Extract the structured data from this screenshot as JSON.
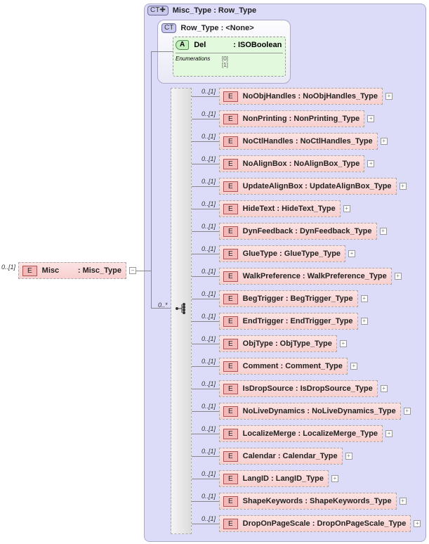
{
  "root": {
    "cardinality": "0..[1]",
    "badge": "E",
    "name": "Misc",
    "type": ": Misc_Type",
    "toggle": "−"
  },
  "complex_type": {
    "badge": "CT✚",
    "title": "Misc_Type : Row_Type"
  },
  "base_type": {
    "badge": "CT",
    "title": "Row_Type : <None>"
  },
  "attribute": {
    "badge": "A",
    "name": "Del",
    "type": ": ISOBoolean",
    "enum_label": "Enumerations",
    "enum_values": [
      "[0]",
      "[1]"
    ]
  },
  "sequence": {
    "cardinality": "0..*"
  },
  "elements": [
    {
      "card": "0..[1]",
      "name": "NoObjHandles",
      "type": ": NoObjHandles_Type"
    },
    {
      "card": "0..[1]",
      "name": "NonPrinting",
      "type": ": NonPrinting_Type"
    },
    {
      "card": "0..[1]",
      "name": "NoCtlHandles",
      "type": ": NoCtlHandles_Type"
    },
    {
      "card": "0..[1]",
      "name": "NoAlignBox",
      "type": ": NoAlignBox_Type"
    },
    {
      "card": "0..[1]",
      "name": "UpdateAlignBox",
      "type": ": UpdateAlignBox_Type"
    },
    {
      "card": "0..[1]",
      "name": "HideText",
      "type": ": HideText_Type"
    },
    {
      "card": "0..[1]",
      "name": "DynFeedback",
      "type": ": DynFeedback_Type"
    },
    {
      "card": "0..[1]",
      "name": "GlueType",
      "type": ": GlueType_Type"
    },
    {
      "card": "0..[1]",
      "name": "WalkPreference",
      "type": ": WalkPreference_Type"
    },
    {
      "card": "0..[1]",
      "name": "BegTrigger",
      "type": ": BegTrigger_Type"
    },
    {
      "card": "0..[1]",
      "name": "EndTrigger",
      "type": ": EndTrigger_Type"
    },
    {
      "card": "0..[1]",
      "name": "ObjType",
      "type": ": ObjType_Type"
    },
    {
      "card": "0..[1]",
      "name": "Comment",
      "type": ": Comment_Type"
    },
    {
      "card": "0..[1]",
      "name": "IsDropSource",
      "type": ": IsDropSource_Type"
    },
    {
      "card": "0..[1]",
      "name": "NoLiveDynamics",
      "type": ": NoLiveDynamics_Type"
    },
    {
      "card": "0..[1]",
      "name": "LocalizeMerge",
      "type": ": LocalizeMerge_Type"
    },
    {
      "card": "0..[1]",
      "name": "Calendar",
      "type": ": Calendar_Type"
    },
    {
      "card": "0..[1]",
      "name": "LangID",
      "type": ": LangID_Type"
    },
    {
      "card": "0..[1]",
      "name": "ShapeKeywords",
      "type": ": ShapeKeywords_Type"
    },
    {
      "card": "0..[1]",
      "name": "DropOnPageScale",
      "type": ": DropOnPageScale_Type"
    }
  ]
}
